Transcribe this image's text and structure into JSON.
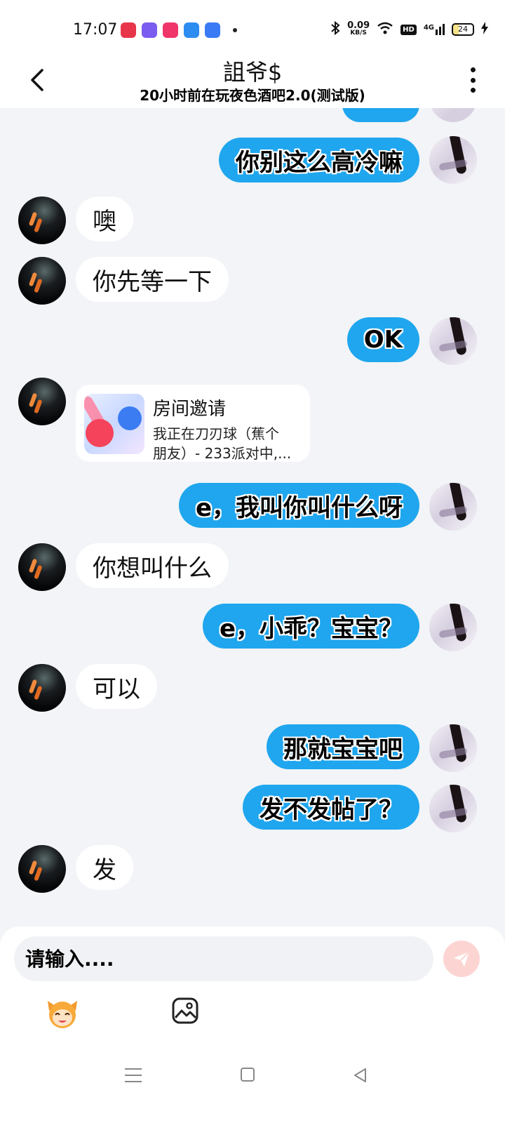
{
  "status_bar": {
    "time": "17:07",
    "net_speed": "0.09",
    "net_unit": "KB/S",
    "hd": "HD",
    "signal": "4G",
    "battery": "24"
  },
  "header": {
    "contact_name": "詛爷$",
    "status_line": "20小时前在玩夜色酒吧2.0(测试版)"
  },
  "messages": [
    {
      "side": "self",
      "text": "你别这么高冷嘛"
    },
    {
      "side": "other",
      "text": "噢"
    },
    {
      "side": "other",
      "text": "你先等一下"
    },
    {
      "side": "self",
      "text": "OK"
    },
    {
      "side": "other",
      "type": "card",
      "title": "房间邀请",
      "desc_line1": "我正在刀刃球（蕉个",
      "desc_line2": "朋友）- 233派对中,..."
    },
    {
      "side": "self",
      "text": "e，我叫你叫什么呀"
    },
    {
      "side": "other",
      "text": "你想叫什么"
    },
    {
      "side": "self",
      "text": "e，小乖？宝宝？"
    },
    {
      "side": "other",
      "text": "可以"
    },
    {
      "side": "self",
      "text": "那就宝宝吧"
    },
    {
      "side": "self",
      "text": "发不发帖了？"
    },
    {
      "side": "other",
      "text": "发"
    }
  ],
  "input": {
    "placeholder": "请输入...."
  },
  "icons": {
    "back": "chevron-left-icon",
    "more": "more-vertical-icon",
    "send": "paper-plane-icon",
    "emoji": "emoji-face-icon",
    "image": "image-icon"
  },
  "colors": {
    "self_bubble": "#1fa6ee",
    "other_bubble": "#ffffff",
    "chat_background": "#f2f4f7",
    "send_button": "#fcd5d2"
  }
}
